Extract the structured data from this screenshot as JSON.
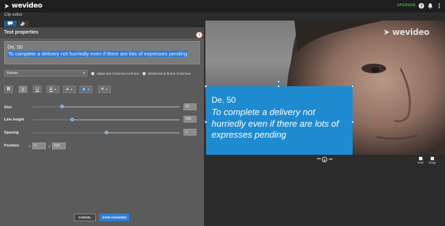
{
  "top_bar": {
    "logo_text": "wevideo",
    "upgrade_label": "UPGRADE",
    "help_icon": "help-icon",
    "bell_icon": "bell-icon",
    "menu_icon": "menu-icon"
  },
  "clip_editor_label": "Clip editor",
  "tabs": [
    {
      "icon": "speech-bubble-icon",
      "active": true
    },
    {
      "icon": "eraser-icon",
      "active": false
    }
  ],
  "panel": {
    "title": "Text properties",
    "badge": "1",
    "text_line1": "De. 50",
    "text_line2": "To complete a delivery not hurriedly even if there are lots of expresses pending",
    "font_select": "Roboto",
    "adjust_checkbox_label": "Adjust size of text box to fit text",
    "shrink_checkbox_label": "Shrink text to fit size of text box",
    "format_buttons": {
      "bold": "B",
      "italic": "I",
      "underline": "U",
      "text_color": "A",
      "bg_color": "A",
      "highlight": "A",
      "align": "≡"
    },
    "size": {
      "label": "Size",
      "value": "82",
      "level": 0.2
    },
    "line_height": {
      "label": "Line height",
      "value": "345",
      "level": 0.27
    },
    "spacing": {
      "label": "Spacing",
      "value": "2",
      "level": 0.5
    },
    "position": {
      "label": "Position",
      "x_label": "x",
      "x": "0",
      "y_label": "y",
      "y": "534"
    },
    "cancel_label": "CANCEL",
    "save_label": "SAVE CHANGES"
  },
  "preview": {
    "watermark": "wevideo",
    "caption_line1": "De. 50",
    "caption_line2": "To complete a delivery not hurriedly even if there are lots of expresses pending",
    "grid_label": "Grid",
    "snap_label": "Snap"
  },
  "colors": {
    "accent": "#2f7fd2",
    "caption_bg": "#1e8bd1",
    "upgrade": "#36c04c"
  }
}
